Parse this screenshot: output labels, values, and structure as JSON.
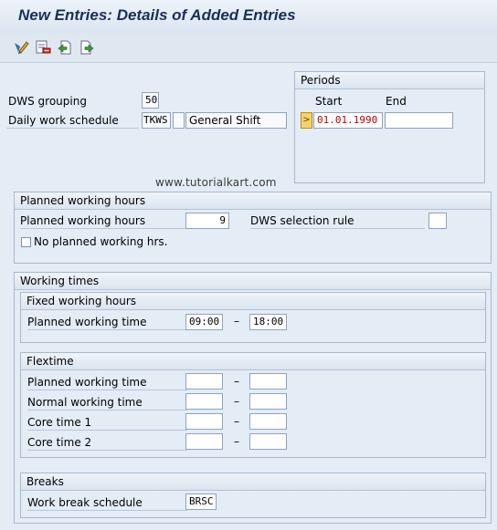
{
  "window": {
    "title": "New Entries: Details of Added Entries"
  },
  "toolbar": {
    "icons": [
      "change-icon",
      "delete-row-icon",
      "previous-entry-icon",
      "next-entry-icon"
    ]
  },
  "header": {
    "dws_grouping_label": "DWS grouping",
    "dws_grouping_value": "50",
    "daily_work_schedule_label": "Daily work schedule",
    "daily_work_schedule_value": "TKWS",
    "daily_work_schedule_variant": "",
    "daily_work_schedule_text": "General Shift"
  },
  "periods": {
    "title": "Periods",
    "start_label": "Start",
    "end_label": "End",
    "select_indicator": ">",
    "start_value": "01.01.1990",
    "end_value": ""
  },
  "watermark": "www.tutorialkart.com",
  "planned": {
    "title": "Planned working hours",
    "planned_hours_label": "Planned working hours",
    "planned_hours_value": "9",
    "dws_selection_rule_label": "DWS selection rule",
    "dws_selection_rule_value": "",
    "no_planned_label": "No planned working hrs."
  },
  "working_times": {
    "title": "Working times",
    "fixed": {
      "title": "Fixed working hours",
      "planned_time_label": "Planned working time",
      "from": "09:00",
      "sep": "–",
      "to": "18:00"
    },
    "flextime": {
      "title": "Flextime",
      "rows": [
        {
          "label": "Planned working time",
          "from": "",
          "to": ""
        },
        {
          "label": "Normal working time",
          "from": "",
          "to": ""
        },
        {
          "label": "Core time 1",
          "from": "",
          "to": ""
        },
        {
          "label": "Core time 2",
          "from": "",
          "to": ""
        }
      ],
      "sep": "–"
    },
    "breaks": {
      "title": "Breaks",
      "schedule_label": "Work break schedule",
      "schedule_value": "BRSC"
    }
  },
  "colors": {
    "background": "#e4ecf6",
    "title": "#1c2e55",
    "date_red": "#c00000",
    "select_button": "#f4d46a"
  }
}
